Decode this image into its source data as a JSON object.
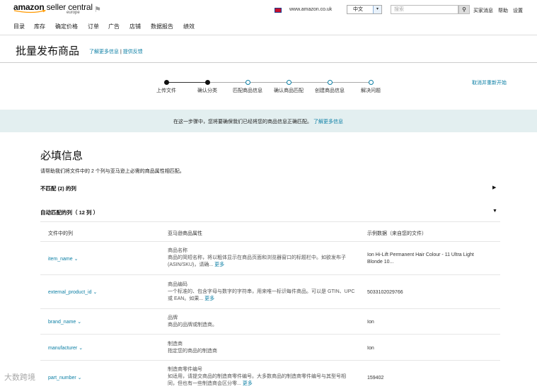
{
  "header": {
    "logo_main": "amazon",
    "logo_sub": "seller central",
    "logo_region": "europe",
    "domain": "www.amazon.co.uk",
    "language": "中文",
    "search_placeholder": "搜索",
    "links": [
      "买家消息",
      "帮助",
      "设置"
    ],
    "nav": [
      "目录",
      "库存",
      "确定价格",
      "订单",
      "广告",
      "店铺",
      "数据报告",
      "绩效"
    ]
  },
  "page": {
    "title": "批量发布商品",
    "learn_more": "了解更多信息",
    "divider": "|",
    "feedback": "提供反馈"
  },
  "stepper": {
    "steps": [
      "上传文件",
      "确认分类",
      "匹配商品信息",
      "确认商品匹配",
      "创建商品信息",
      "解决问题"
    ],
    "completed": 2,
    "restart": "取消并重新开始"
  },
  "banner": {
    "text": "在这一步骤中，您将要确保我们已经将您的商品信息正确匹配。",
    "link": "了解更多信息"
  },
  "required": {
    "title": "必填信息",
    "description": "请帮助我们将文件中的 2 个列与亚马逊上必需的商品属性相匹配。",
    "unmatched_label": "不匹配 (2) 的列",
    "auto_label": "自动匹配的列（ 12 列 ）",
    "columns": [
      "文件中的列",
      "亚马逊商品属性",
      "示例数据（来自您的文件）"
    ],
    "rows": [
      {
        "name": "item_name",
        "attr_title": "商品名称",
        "attr_desc": "商品的简短名称，将以粗体显示在商品页面和浏览器窗口的标题栏中。如欲发布子 (ASIN/SKU)，请确...",
        "more": "更多",
        "sample": "Ion Hi-Lift Permanent Hair Colour - 11 Ultra Light Blonde 10..."
      },
      {
        "name": "external_product_id",
        "attr_title": "商品编码",
        "attr_desc": "一个标准的、包含字母与数字的字符串，用来唯一标识每件商品。可以是 GTIN、UPC 或 EAN。如果...",
        "more": "更多",
        "sample": "5033102029766"
      },
      {
        "name": "brand_name",
        "attr_title": "品牌",
        "attr_desc": "商品的品牌或制造商。",
        "more": "",
        "sample": "Ion"
      },
      {
        "name": "manufacturer",
        "attr_title": "制造商",
        "attr_desc": "指定您的商品的制造商",
        "more": "",
        "sample": "Ion"
      },
      {
        "name": "part_number",
        "attr_title": "制造商零件编号",
        "attr_desc": "如适用，请提交商品的制造商零件编号。大多数商品的制造商零件编号与其型号相同，但也有一些制造商会区分零...",
        "more": "更多",
        "sample": "159402"
      }
    ]
  },
  "colors": {
    "link": "#0a7ea4",
    "band": "#e3eff0",
    "logo_arrow": "#ff9900"
  },
  "watermark": "大数跨境"
}
